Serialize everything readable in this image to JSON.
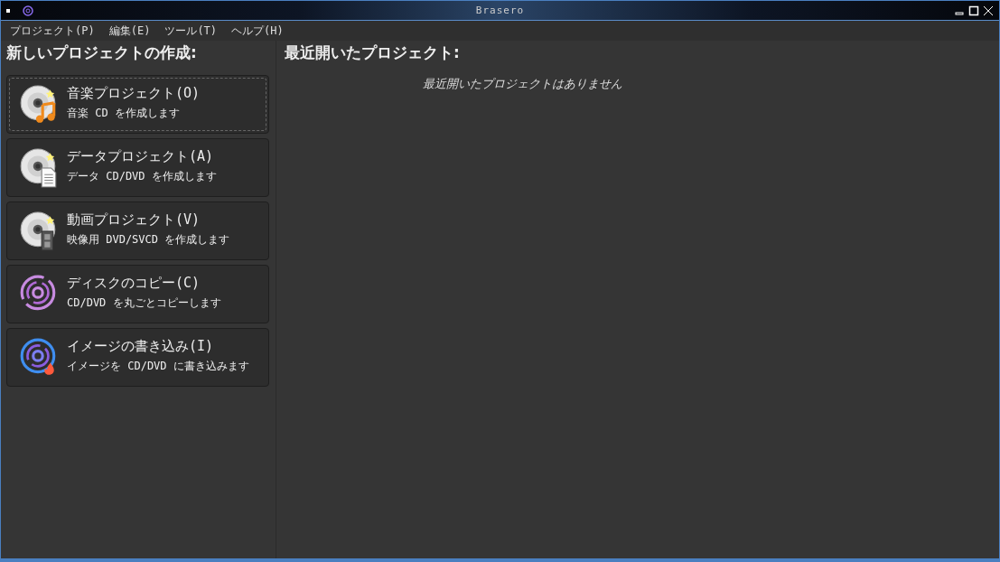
{
  "window": {
    "title": "Brasero"
  },
  "menu": [
    "プロジェクト(P)",
    "編集(E)",
    "ツール(T)",
    "ヘルプ(H)"
  ],
  "new_project": {
    "heading": "新しいプロジェクトの作成:",
    "buttons": [
      {
        "kind": "audio",
        "title": "音楽プロジェクト(O)",
        "description": "音楽 CD を作成します",
        "focused": true
      },
      {
        "kind": "data",
        "title": "データプロジェクト(A)",
        "description": "データ CD/DVD を作成します",
        "focused": false
      },
      {
        "kind": "video",
        "title": "動画プロジェクト(V)",
        "description": "映像用 DVD/SVCD を作成します",
        "focused": false
      },
      {
        "kind": "copy",
        "title": "ディスクのコピー(C)",
        "description": "CD/DVD を丸ごとコピーします",
        "focused": false
      },
      {
        "kind": "burn",
        "title": "イメージの書き込み(I)",
        "description": "イメージを CD/DVD に書き込みます",
        "focused": false
      }
    ]
  },
  "recent": {
    "heading": "最近開いたプロジェクト:",
    "empty_message": "最近開いたプロジェクトはありません"
  }
}
